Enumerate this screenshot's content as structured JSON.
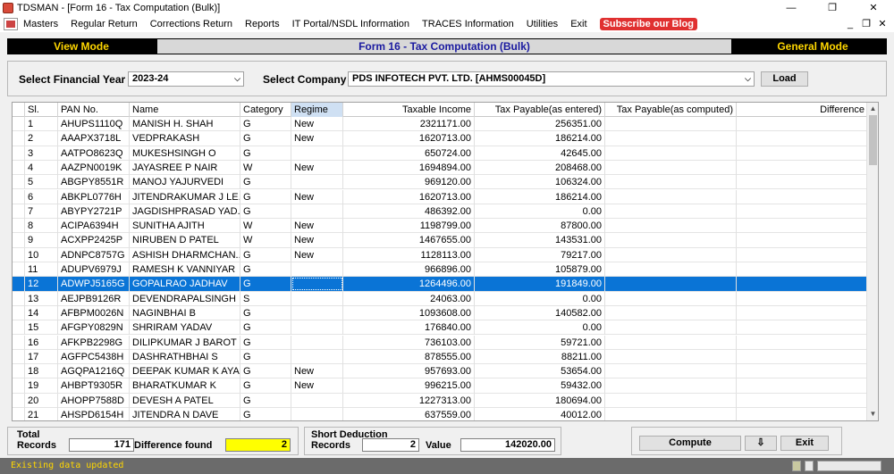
{
  "window": {
    "title": "TDSMAN - [Form 16 - Tax Computation (Bulk)]",
    "minimize": "—",
    "restore": "❐",
    "close": "✕"
  },
  "menu": {
    "items": [
      "Masters",
      "Regular Return",
      "Corrections Return",
      "Reports",
      "IT Portal/NSDL Information",
      "TRACES Information",
      "Utilities",
      "Exit"
    ],
    "subscribe": "Subscribe our Blog",
    "mdi_min": "_",
    "mdi_restore": "❐",
    "mdi_close": "✕"
  },
  "mode": {
    "left": "View Mode",
    "center": "Form 16 - Tax Computation (Bulk)",
    "right": "General Mode"
  },
  "filters": {
    "year_label": "Select Financial Year",
    "year_value": "2023-24",
    "company_label": "Select Company",
    "company_value": "PDS INFOTECH PVT. LTD. [AHMS00045D]",
    "load_label": "Load",
    "arrow": "⌵"
  },
  "grid": {
    "columns": [
      "Sl.",
      "PAN No.",
      "Name",
      "Category",
      "Regime",
      "Taxable Income",
      "Tax Payable(as entered)",
      "Tax Payable(as computed)",
      "Difference"
    ],
    "selected_row": 11,
    "rows": [
      [
        "1",
        "AHUPS1110Q",
        "MANISH H. SHAH",
        "G",
        "New",
        "2321171.00",
        "256351.00",
        "",
        ""
      ],
      [
        "2",
        "AAAPX3718L",
        "VEDPRAKASH",
        "G",
        "New",
        "1620713.00",
        "186214.00",
        "",
        ""
      ],
      [
        "3",
        "AATPO8623Q",
        "MUKESHSINGH O",
        "G",
        "",
        "650724.00",
        "42645.00",
        "",
        ""
      ],
      [
        "4",
        "AAZPN0019K",
        "JAYASREE P NAIR",
        "W",
        "New",
        "1694894.00",
        "208468.00",
        "",
        ""
      ],
      [
        "5",
        "ABGPY8551R",
        "MANOJ YAJURVEDI",
        "G",
        "",
        "969120.00",
        "106324.00",
        "",
        ""
      ],
      [
        "6",
        "ABKPL0776H",
        "JITENDRAKUMAR J LE...",
        "G",
        "New",
        "1620713.00",
        "186214.00",
        "",
        ""
      ],
      [
        "7",
        "ABYPY2721P",
        "JAGDISHPRASAD YAD...",
        "G",
        "",
        "486392.00",
        "0.00",
        "",
        ""
      ],
      [
        "8",
        "ACIPA6394H",
        "SUNITHA AJITH",
        "W",
        "New",
        "1198799.00",
        "87800.00",
        "",
        ""
      ],
      [
        "9",
        "ACXPP2425P",
        "NIRUBEN D PATEL",
        "W",
        "New",
        "1467655.00",
        "143531.00",
        "",
        ""
      ],
      [
        "10",
        "ADNPC8757G",
        "ASHISH DHARMCHAN...",
        "G",
        "New",
        "1128113.00",
        "79217.00",
        "",
        ""
      ],
      [
        "11",
        "ADUPV6979J",
        "RAMESH K VANNIYAR",
        "G",
        "",
        "966896.00",
        "105879.00",
        "",
        ""
      ],
      [
        "12",
        "ADWPJ5165G",
        "GOPALRAO JADHAV",
        "G",
        "",
        "1264496.00",
        "191849.00",
        "",
        ""
      ],
      [
        "13",
        "AEJPB9126R",
        "DEVENDRAPALSINGH ...",
        "S",
        "",
        "24063.00",
        "0.00",
        "",
        ""
      ],
      [
        "14",
        "AFBPM0026N",
        "NAGINBHAI B",
        "G",
        "",
        "1093608.00",
        "140582.00",
        "",
        ""
      ],
      [
        "15",
        "AFGPY0829N",
        "SHRIRAM YADAV",
        "G",
        "",
        "176840.00",
        "0.00",
        "",
        ""
      ],
      [
        "16",
        "AFKPB2298G",
        "DILIPKUMAR J BAROT",
        "G",
        "",
        "736103.00",
        "59721.00",
        "",
        ""
      ],
      [
        "17",
        "AGFPC5438H",
        "DASHRATHBHAI S",
        "G",
        "",
        "878555.00",
        "88211.00",
        "",
        ""
      ],
      [
        "18",
        "AGQPA1216Q",
        "DEEPAK KUMAR K AYAR",
        "G",
        "New",
        "957693.00",
        "53654.00",
        "",
        ""
      ],
      [
        "19",
        "AHBPT9305R",
        "BHARATKUMAR K",
        "G",
        "New",
        "996215.00",
        "59432.00",
        "",
        ""
      ],
      [
        "20",
        "AHOPP7588D",
        "DEVESH A PATEL",
        "G",
        "",
        "1227313.00",
        "180694.00",
        "",
        ""
      ],
      [
        "21",
        "AHSPD6154H",
        "JITENDRA N DAVE",
        "G",
        "",
        "637559.00",
        "40012.00",
        "",
        ""
      ]
    ]
  },
  "footer": {
    "total_label": "Total",
    "records_label": "Records",
    "total_records": "171",
    "diff_label": "Difference found",
    "diff_value": "2",
    "short_label": "Short Deduction",
    "short_records_label": "Records",
    "short_records": "2",
    "value_label": "Value",
    "value": "142020.00",
    "compute_label": "Compute",
    "down_label": "⇩",
    "exit_label": "Exit"
  },
  "status": {
    "message": "Existing data updated"
  },
  "colors": {
    "selection": "#0a74d6",
    "mode_text": "#ffd700",
    "status_text": "#ffd700",
    "diff_bg": "#ffff00"
  }
}
